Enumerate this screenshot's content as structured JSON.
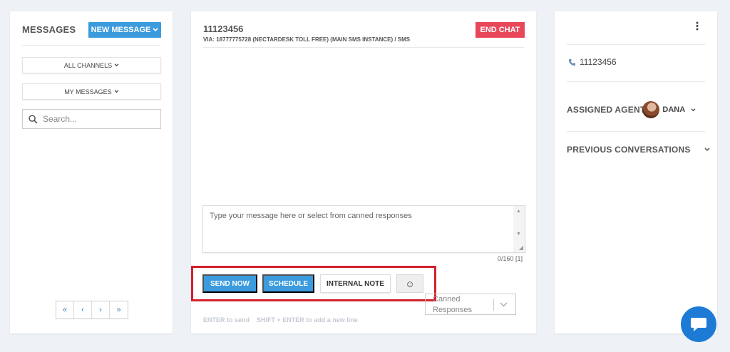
{
  "sidebar": {
    "title": "MESSAGES",
    "new_message_label": "NEW MESSAGE",
    "all_channels_label": "ALL CHANNELS",
    "my_messages_label": "MY MESSAGES",
    "search_placeholder": "Search...",
    "pager": {
      "first": "«",
      "prev": "‹",
      "next": "›",
      "last": "»"
    }
  },
  "chat": {
    "contact_id": "11123456",
    "via": "VIA: 18777775728 (NECTARDESK TOLL FREE) (MAIN SMS INSTANCE) / SMS",
    "end_chat_label": "END CHAT",
    "message_placeholder": "Type your message here or select from canned responses",
    "char_counter": "0/160 [1]",
    "send_now_label": "SEND NOW",
    "schedule_label": "SCHEDULE",
    "internal_note_label": "INTERNAL NOTE",
    "emoji_glyph": "☺",
    "canned_placeholder": "Canned Responses",
    "hint": "ENTER to send    SHIFT + ENTER to add a new line"
  },
  "details": {
    "phone": "11123456",
    "assigned_agent_label": "ASSIGNED AGENT",
    "agent_name": "DANA",
    "previous_conversations_label": "PREVIOUS CONVERSATIONS"
  },
  "colors": {
    "accent_blue": "#3b9bdd",
    "danger_red": "#e8475a",
    "highlight_red": "#d4202c",
    "fab_blue": "#1d7bd6",
    "background": "#eef1f5"
  },
  "icons": [
    "chevron-down-icon",
    "search-icon",
    "phone-icon",
    "kebab-menu-icon",
    "chat-bubble-icon"
  ]
}
